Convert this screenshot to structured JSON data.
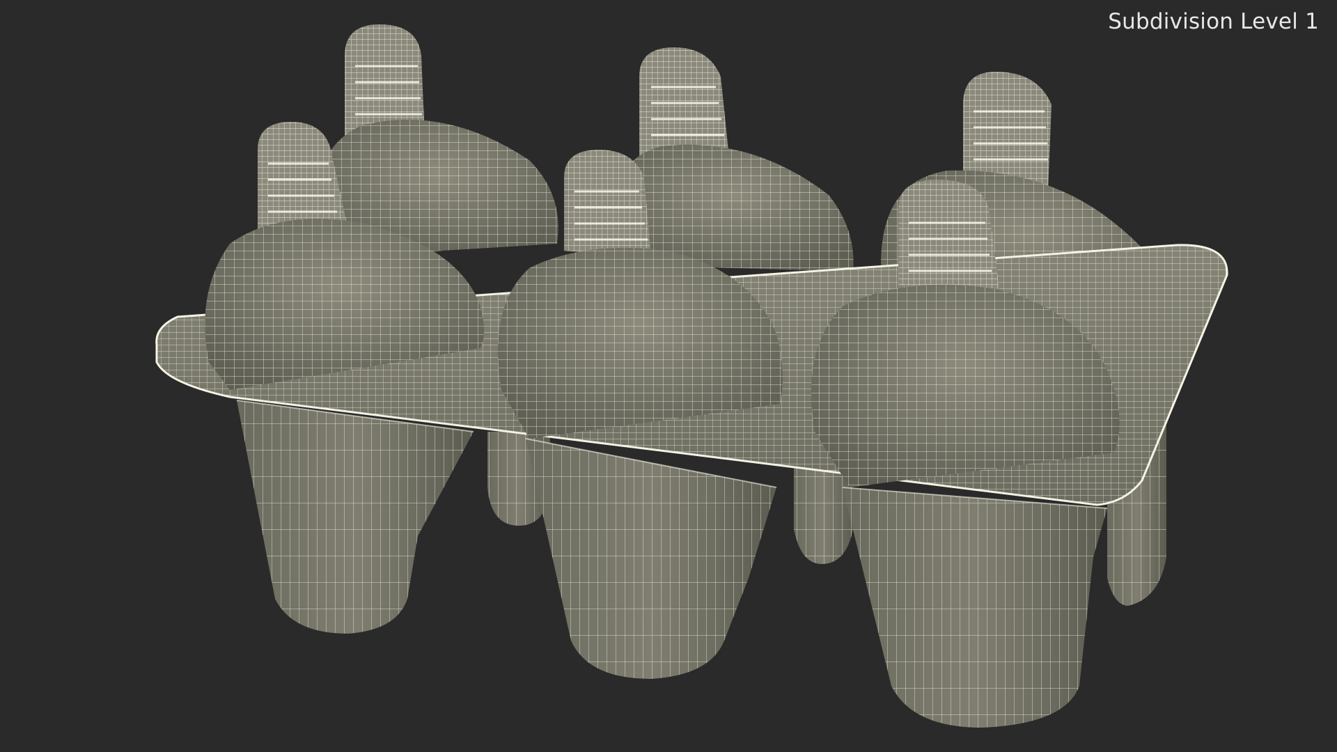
{
  "viewport": {
    "label": "Subdivision Level 1",
    "background": "#2a2a2a"
  },
  "model": {
    "subject": "popsicle-mold-tray",
    "mold_count": 6,
    "render_style": "wireframe",
    "colors": {
      "surface": "#7c7c6e",
      "surface_light": "#8c8b7c",
      "surface_dark": "#5e5e53",
      "wire": "#eeeedd",
      "rim": "#f4f3e4"
    }
  }
}
